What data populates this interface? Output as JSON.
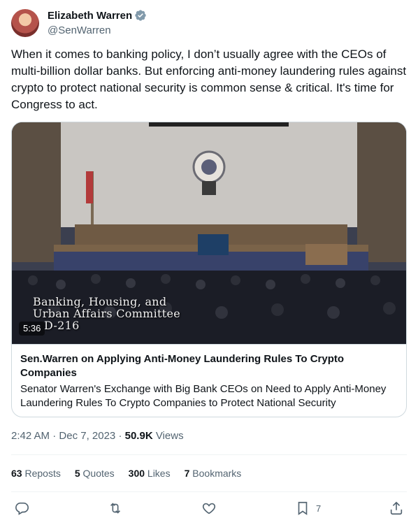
{
  "author": {
    "name": "Elizabeth Warren",
    "handle": "@SenWarren"
  },
  "tweet": {
    "text": "When it comes to banking policy, I don’t usually agree with the CEOs of multi-billion dollar banks. But enforcing anti-money laundering rules against crypto to protect national security is common sense & critical. It's time for Congress to act."
  },
  "card": {
    "video_duration": "5:36",
    "caption_line1": "Banking, Housing, and",
    "caption_line2": "Urban Affairs Committee",
    "caption_line3": "D-216",
    "title": "Sen.Warren on Applying Anti-Money Laundering Rules To Crypto Companies",
    "description": "Senator Warren's Exchange with Big Bank CEOs on Need to Apply Anti-Money Laundering Rules To Crypto Companies to Protect National Security"
  },
  "meta": {
    "time": "2:42 AM",
    "separator": " · ",
    "date": "Dec 7, 2023",
    "views_count": "50.9K",
    "views_label": "Views"
  },
  "stats": {
    "reposts_count": "63",
    "reposts_label": "Reposts",
    "quotes_count": "5",
    "quotes_label": "Quotes",
    "likes_count": "300",
    "likes_label": "Likes",
    "bookmarks_count": "7",
    "bookmarks_label": "Bookmarks"
  },
  "actions": {
    "bookmark_count": "7"
  },
  "colors": {
    "verified_badge": "#829aab",
    "secondary_text": "#536471",
    "border": "#cfd9de"
  }
}
